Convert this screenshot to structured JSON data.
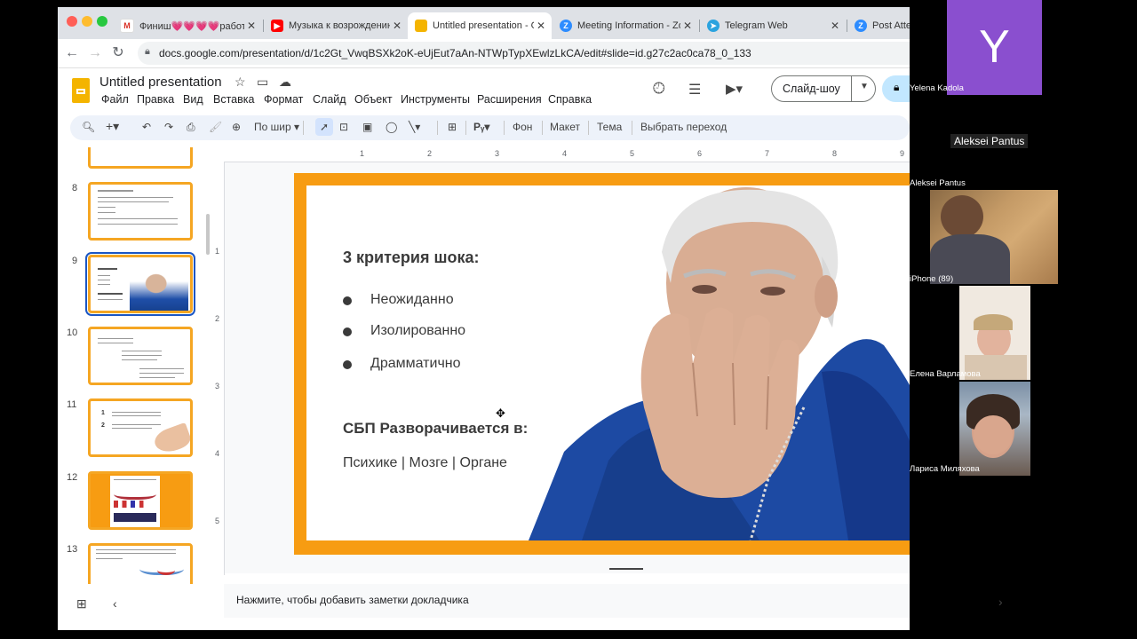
{
  "browser": {
    "tabs": [
      {
        "label": "Финиш💗💗💗💗работ",
        "favicon_color": "#ffffff",
        "favicon_text": "M"
      },
      {
        "label": "Музыка к возрождению",
        "favicon_color": "#ff0000",
        "favicon_text": "▶"
      },
      {
        "label": "Untitled presentation - G",
        "favicon_color": "#f4b400",
        "favicon_text": ""
      },
      {
        "label": "Meeting Information - Zo",
        "favicon_color": "#2d8cff",
        "favicon_text": "Z"
      },
      {
        "label": "Telegram Web",
        "favicon_color": "#2aa3df",
        "favicon_text": "➤"
      },
      {
        "label": "Post Atte",
        "favicon_color": "#2d8cff",
        "favicon_text": "Z"
      }
    ],
    "url": "docs.google.com/presentation/d/1c2Gt_VwqBSXk2oK-eUjEut7aAn-NTWpTypXEwlzLkCA/edit#slide=id.g27c2ac0ca78_0_133"
  },
  "docs": {
    "title": "Untitled presentation",
    "menu": [
      "Файл",
      "Правка",
      "Вид",
      "Вставка",
      "Формат",
      "Слайд",
      "Объект",
      "Инструменты",
      "Расширения",
      "Справка"
    ],
    "slideshow_label": "Слайд-шоу",
    "toolbar": {
      "zoom_label": "По шир",
      "background": "Фон",
      "layout": "Макет",
      "theme": "Тема",
      "transition": "Выбрать переход"
    },
    "accent_color": "#f79c12"
  },
  "filmstrip": {
    "slides": [
      {
        "number": "8"
      },
      {
        "number": "9",
        "selected": true
      },
      {
        "number": "10"
      },
      {
        "number": "11"
      },
      {
        "number": "12"
      },
      {
        "number": "13"
      }
    ]
  },
  "ruler": {
    "h": [
      "1",
      "2",
      "3",
      "4",
      "5",
      "6",
      "7",
      "8",
      "9"
    ],
    "v": [
      "1",
      "2",
      "3",
      "4",
      "5"
    ]
  },
  "slide": {
    "title": "3 критерия шока:",
    "bullets": [
      "Неожиданно",
      "Изолированно",
      "Драмматично"
    ],
    "sbp_heading": "СБП Разворачивается в:",
    "organs": "Психике | Мозге | Органе"
  },
  "notes": {
    "placeholder": "Нажмите, чтобы добавить заметки докладчика"
  },
  "zoom": {
    "participants": [
      {
        "name": "Yelena Kadola",
        "avatar_letter": "Y",
        "avatar_color": "#8a4fcf"
      },
      {
        "name": "Aleksei Pantus",
        "caption": "Aleksei Pantus"
      },
      {
        "name": "iPhone (89)"
      },
      {
        "name": "Елена Варламова"
      },
      {
        "name": "Лариса Миляхова"
      }
    ]
  }
}
